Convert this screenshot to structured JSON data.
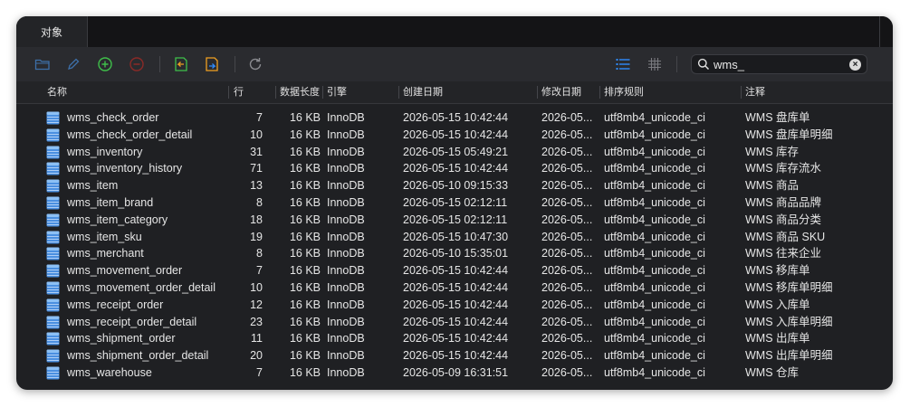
{
  "tab": {
    "label": "对象"
  },
  "search": {
    "value": "wms_"
  },
  "columns": {
    "name": "名称",
    "rows": "行",
    "data_length": "数据长度",
    "engine": "引擎",
    "created": "创建日期",
    "modified": "修改日期",
    "collation": "排序规则",
    "comment": "注释"
  },
  "icons": {
    "open": "folder-icon",
    "design": "pencil-icon",
    "new": "plus-circle-icon",
    "delete": "minus-circle-icon",
    "import": "import-icon",
    "export": "export-icon",
    "refresh": "refresh-icon",
    "list_view": "list-view-icon",
    "grid_view": "grid-view-icon",
    "search": "search-icon",
    "clear": "clear-icon",
    "table": "table-icon"
  },
  "colors": {
    "background": "#1f2023",
    "toolbar": "#2a2b2f",
    "accent": "#2f8cff",
    "add": "#3fbf4a",
    "remove": "#d9403a",
    "transfer": "#f0a020"
  },
  "table": {
    "rows": [
      {
        "name": "wms_check_order",
        "rows": "7",
        "data_length": "16 KB",
        "engine": "InnoDB",
        "created": "2026-05-15 10:42:44",
        "modified": "2026-05...",
        "collation": "utf8mb4_unicode_ci",
        "comment": "WMS 盘库单"
      },
      {
        "name": "wms_check_order_detail",
        "rows": "10",
        "data_length": "16 KB",
        "engine": "InnoDB",
        "created": "2026-05-15 10:42:44",
        "modified": "2026-05...",
        "collation": "utf8mb4_unicode_ci",
        "comment": "WMS 盘库单明细"
      },
      {
        "name": "wms_inventory",
        "rows": "31",
        "data_length": "16 KB",
        "engine": "InnoDB",
        "created": "2026-05-15 05:49:21",
        "modified": "2026-05...",
        "collation": "utf8mb4_unicode_ci",
        "comment": "WMS 库存"
      },
      {
        "name": "wms_inventory_history",
        "rows": "71",
        "data_length": "16 KB",
        "engine": "InnoDB",
        "created": "2026-05-15 10:42:44",
        "modified": "2026-05...",
        "collation": "utf8mb4_unicode_ci",
        "comment": "WMS 库存流水"
      },
      {
        "name": "wms_item",
        "rows": "13",
        "data_length": "16 KB",
        "engine": "InnoDB",
        "created": "2026-05-10 09:15:33",
        "modified": "2026-05...",
        "collation": "utf8mb4_unicode_ci",
        "comment": "WMS 商品"
      },
      {
        "name": "wms_item_brand",
        "rows": "8",
        "data_length": "16 KB",
        "engine": "InnoDB",
        "created": "2026-05-15 02:12:11",
        "modified": "2026-05...",
        "collation": "utf8mb4_unicode_ci",
        "comment": "WMS 商品品牌"
      },
      {
        "name": "wms_item_category",
        "rows": "18",
        "data_length": "16 KB",
        "engine": "InnoDB",
        "created": "2026-05-15 02:12:11",
        "modified": "2026-05...",
        "collation": "utf8mb4_unicode_ci",
        "comment": "WMS 商品分类"
      },
      {
        "name": "wms_item_sku",
        "rows": "19",
        "data_length": "16 KB",
        "engine": "InnoDB",
        "created": "2026-05-15 10:47:30",
        "modified": "2026-05...",
        "collation": "utf8mb4_unicode_ci",
        "comment": "WMS 商品 SKU"
      },
      {
        "name": "wms_merchant",
        "rows": "8",
        "data_length": "16 KB",
        "engine": "InnoDB",
        "created": "2026-05-10 15:35:01",
        "modified": "2026-05...",
        "collation": "utf8mb4_unicode_ci",
        "comment": "WMS 往来企业"
      },
      {
        "name": "wms_movement_order",
        "rows": "7",
        "data_length": "16 KB",
        "engine": "InnoDB",
        "created": "2026-05-15 10:42:44",
        "modified": "2026-05...",
        "collation": "utf8mb4_unicode_ci",
        "comment": "WMS 移库单"
      },
      {
        "name": "wms_movement_order_detail",
        "rows": "10",
        "data_length": "16 KB",
        "engine": "InnoDB",
        "created": "2026-05-15 10:42:44",
        "modified": "2026-05...",
        "collation": "utf8mb4_unicode_ci",
        "comment": "WMS 移库单明细"
      },
      {
        "name": "wms_receipt_order",
        "rows": "12",
        "data_length": "16 KB",
        "engine": "InnoDB",
        "created": "2026-05-15 10:42:44",
        "modified": "2026-05...",
        "collation": "utf8mb4_unicode_ci",
        "comment": "WMS 入库单"
      },
      {
        "name": "wms_receipt_order_detail",
        "rows": "23",
        "data_length": "16 KB",
        "engine": "InnoDB",
        "created": "2026-05-15 10:42:44",
        "modified": "2026-05...",
        "collation": "utf8mb4_unicode_ci",
        "comment": "WMS 入库单明细"
      },
      {
        "name": "wms_shipment_order",
        "rows": "11",
        "data_length": "16 KB",
        "engine": "InnoDB",
        "created": "2026-05-15 10:42:44",
        "modified": "2026-05...",
        "collation": "utf8mb4_unicode_ci",
        "comment": "WMS 出库单"
      },
      {
        "name": "wms_shipment_order_detail",
        "rows": "20",
        "data_length": "16 KB",
        "engine": "InnoDB",
        "created": "2026-05-15 10:42:44",
        "modified": "2026-05...",
        "collation": "utf8mb4_unicode_ci",
        "comment": "WMS 出库单明细"
      },
      {
        "name": "wms_warehouse",
        "rows": "7",
        "data_length": "16 KB",
        "engine": "InnoDB",
        "created": "2026-05-09 16:31:51",
        "modified": "2026-05...",
        "collation": "utf8mb4_unicode_ci",
        "comment": "WMS 仓库"
      }
    ]
  }
}
